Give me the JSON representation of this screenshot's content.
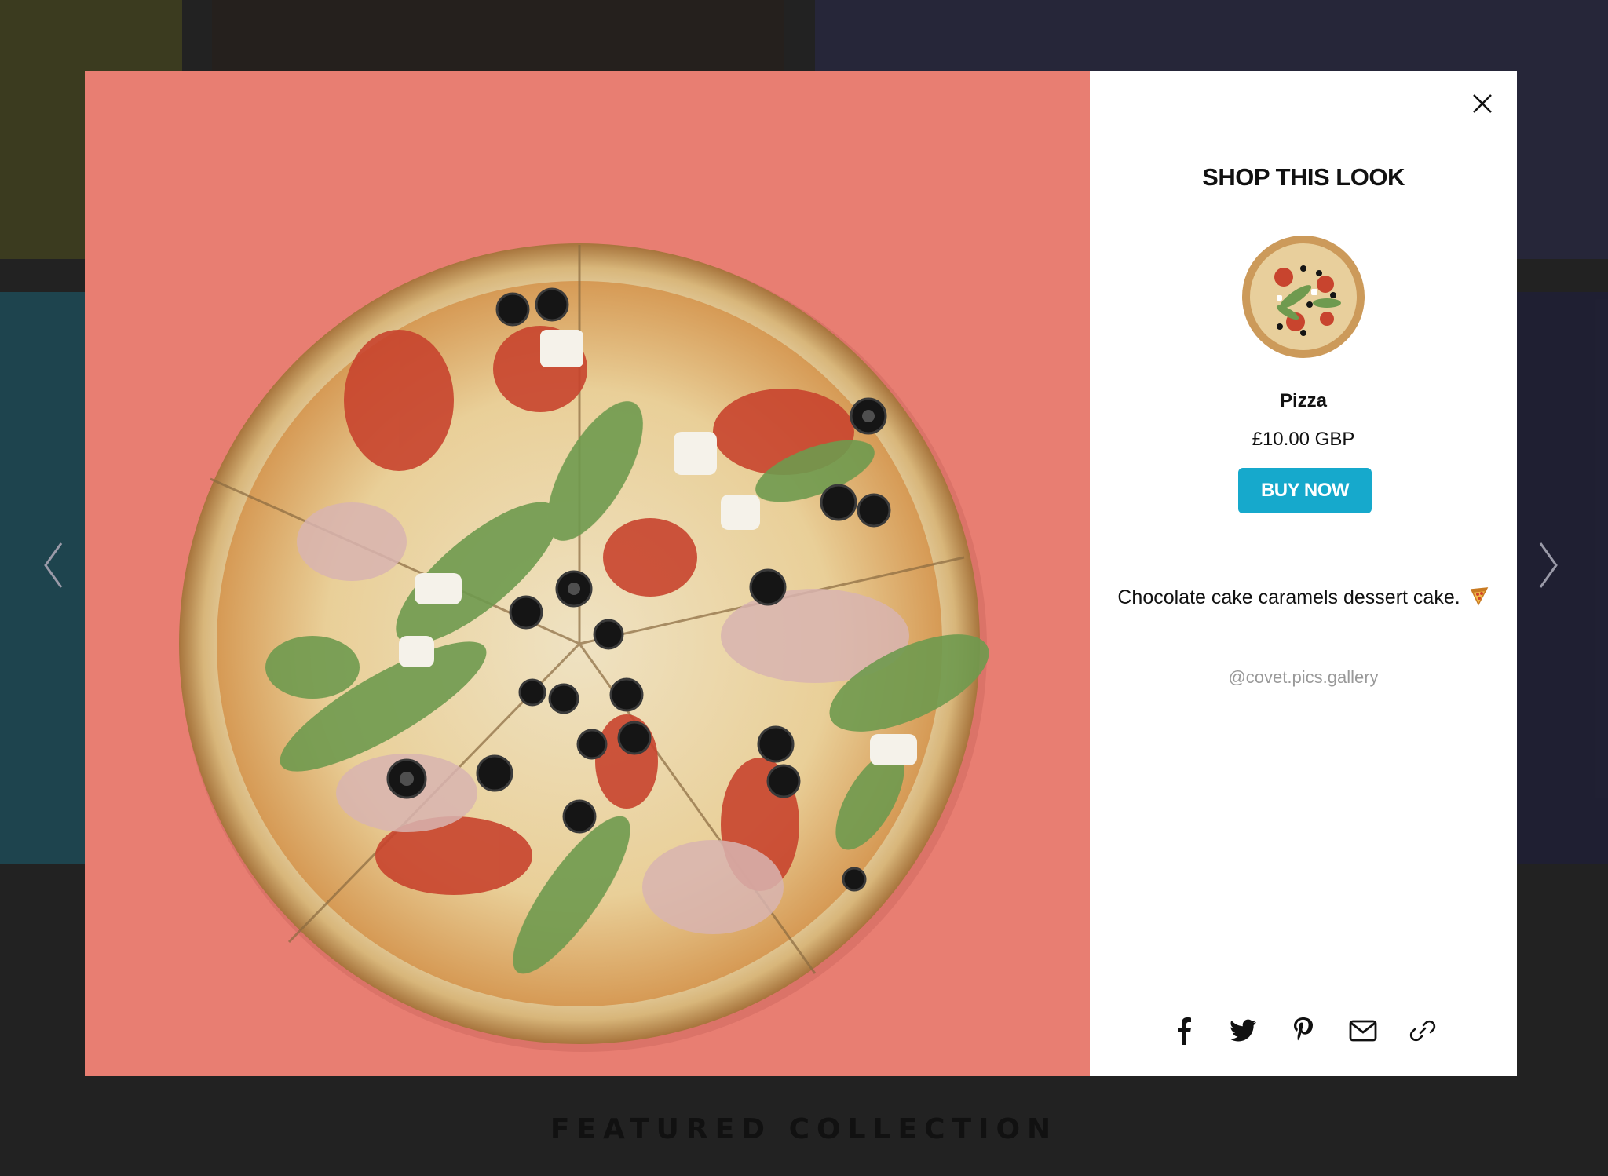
{
  "background": {
    "featured_title": "FEATURED COLLECTION",
    "prev_arrow_icon": "chevron-left-icon",
    "next_arrow_icon": "chevron-right-icon"
  },
  "modal": {
    "image_icon": "pizza-photo",
    "image_bg_color": "#e87e72",
    "close_icon": "close-icon",
    "panel": {
      "title": "SHOP THIS LOOK",
      "product": {
        "name": "Pizza",
        "price": "£10.00 GBP",
        "buy_label": "BUY NOW",
        "buy_color": "#16a9cc"
      },
      "caption": "Chocolate cake caramels dessert cake.",
      "handle": "@covet.pics.gallery",
      "share_icons": [
        "facebook-icon",
        "twitter-icon",
        "pinterest-icon",
        "email-icon",
        "link-icon"
      ]
    }
  }
}
